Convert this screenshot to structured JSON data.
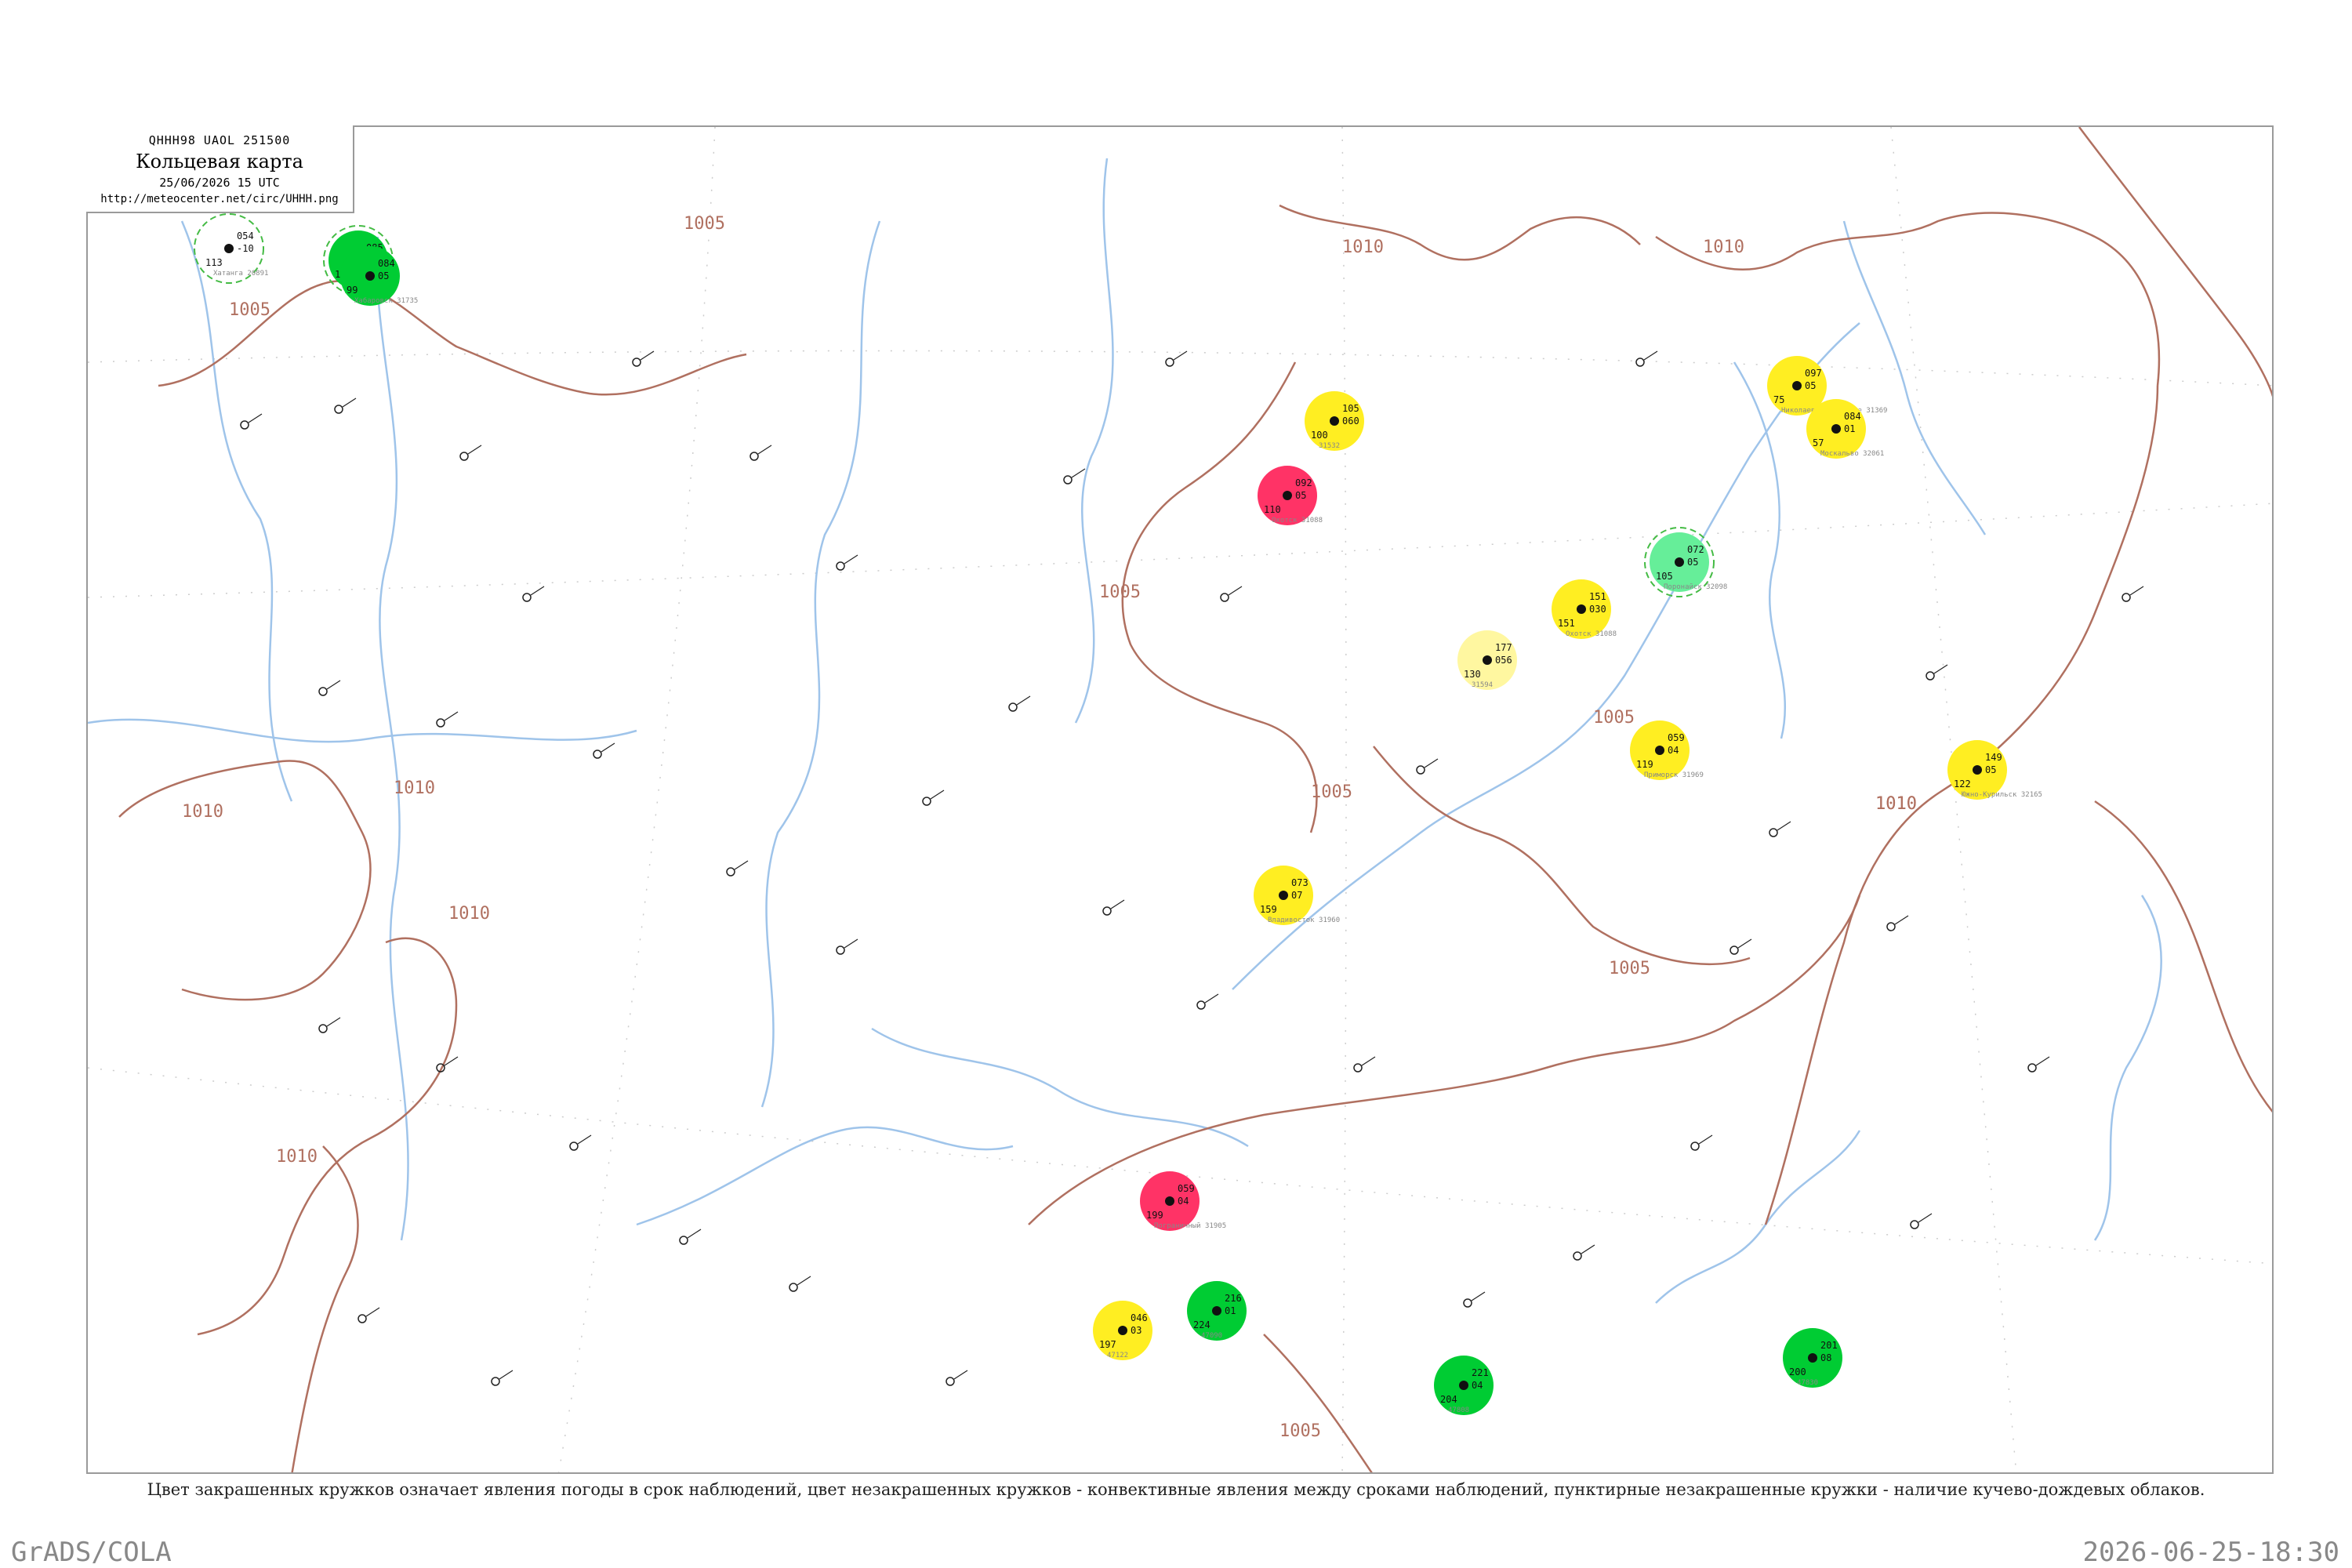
{
  "legend": {
    "code": "QHHH98  UAOL  251500",
    "title": "Кольцевая карта",
    "date": "25/06/2026 15 UTC",
    "url": "http://meteocenter.net/circ/UHHH.png"
  },
  "caption": "Цвет закрашенных кружков означает явления погоды в срок наблюдений, цвет незакрашенных кружков - конвективные явления между сроками наблюдений, пунктирные незакрашенные кружки - наличие кучево-дождевых облаков.",
  "footer": {
    "left": "GrADS/COLA",
    "right": "2026-06-25-18:30"
  },
  "colors": {
    "thunder": "#00cc33",
    "rain": "#ffee22",
    "light_rain": "#fff7a0",
    "heavy": "#ff3366",
    "shower": "#66ee99",
    "isobar": "#b07060",
    "river": "#9fc4ea",
    "cb_circle": "#44bb44",
    "conv_circle": "#cc3355"
  },
  "isobar_labels": [
    "1005",
    "1010",
    "1005",
    "1005",
    "1010",
    "1010",
    "1010",
    "1010",
    "1005",
    "1005",
    "1010",
    "1010",
    "1010",
    "1005",
    "1005"
  ],
  "stations": [
    {
      "name": "Хатанга 20891",
      "p": "054",
      "t": "-10",
      "td": "113",
      "fill": "",
      "ring": "cb"
    },
    {
      "name": "21432",
      "p": "085",
      "t": "05",
      "td": "135",
      "fill": "thunder",
      "ring": "cb"
    },
    {
      "name": "Хабаровск 31735",
      "p": "084",
      "t": "05",
      "td": "99",
      "fill": "thunder",
      "ring": ""
    },
    {
      "name": "Николаевск-на-Амуре 31369",
      "p": "097",
      "t": "05",
      "td": "75",
      "fill": "rain",
      "ring": ""
    },
    {
      "name": "Охотск 31088",
      "p": "092",
      "t": "05",
      "td": "110",
      "fill": "heavy",
      "ring": ""
    },
    {
      "name": "Москальво 32061",
      "p": "084",
      "t": "01",
      "td": "57",
      "fill": "rain",
      "ring": ""
    },
    {
      "name": "Южно-Курильск 32165",
      "p": "149",
      "t": "05",
      "td": "122",
      "fill": "rain",
      "ring": ""
    },
    {
      "name": "Поронайск 32098",
      "p": "072",
      "t": "05",
      "td": "105",
      "fill": "shower",
      "ring": "cb"
    },
    {
      "name": "Владивосток 31960",
      "p": "073",
      "t": "07",
      "td": "159",
      "fill": "rain",
      "ring": ""
    },
    {
      "name": "Приморск 31969",
      "p": "059",
      "t": "04",
      "td": "119",
      "fill": "rain",
      "ring": ""
    },
    {
      "name": "47122",
      "p": "046",
      "t": "03",
      "td": "197",
      "fill": "rain",
      "ring": ""
    },
    {
      "name": "Охотск 31088",
      "p": "151",
      "t": "030",
      "td": "151",
      "fill": "rain",
      "ring": ""
    },
    {
      "name": "31594",
      "p": "177",
      "t": "056",
      "td": "130",
      "fill": "light_rain",
      "ring": ""
    },
    {
      "name": "31532",
      "p": "105",
      "t": "060",
      "td": "100",
      "fill": "rain",
      "ring": ""
    },
    {
      "name": "Пограничный 31905",
      "p": "059",
      "t": "04",
      "td": "199",
      "fill": "heavy",
      "ring": ""
    },
    {
      "name": "47090",
      "p": "216",
      "t": "01",
      "td": "224",
      "fill": "thunder",
      "ring": ""
    },
    {
      "name": "47830",
      "p": "201",
      "t": "08",
      "td": "200",
      "fill": "thunder",
      "ring": ""
    },
    {
      "name": "47808",
      "p": "221",
      "t": "04",
      "td": "204",
      "fill": "thunder",
      "ring": ""
    }
  ]
}
